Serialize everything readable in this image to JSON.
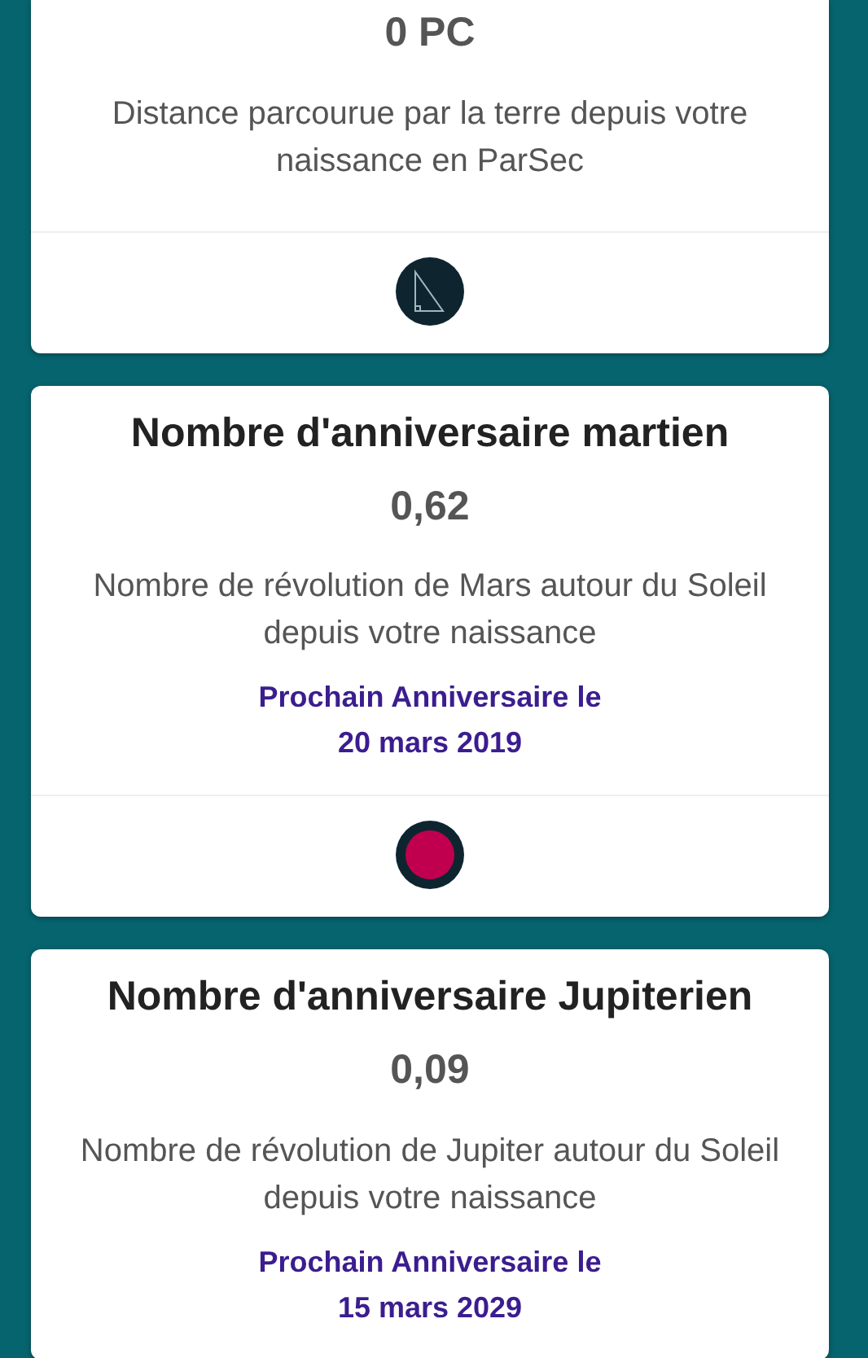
{
  "cards": [
    {
      "cut_top": true,
      "value": "0 PC",
      "description": "Distance parcourue par la terre depuis votre naissance en ParSec",
      "footer": {
        "kind": "triangle"
      }
    },
    {
      "title": "Nombre d'anniversaire martien",
      "value": "0,62",
      "description": "Nombre de révolution de Mars autour du Soleil depuis votre naissance",
      "next_label": "Prochain Anniversaire le",
      "next_date": "20 mars 2019",
      "footer": {
        "kind": "planet"
      }
    },
    {
      "title": "Nombre d'anniversaire Jupiterien",
      "value": "0,09",
      "description": "Nombre de révolution de Jupiter autour du Soleil depuis votre naissance",
      "next_label": "Prochain Anniversaire le",
      "next_date": "15 mars 2029"
    }
  ]
}
